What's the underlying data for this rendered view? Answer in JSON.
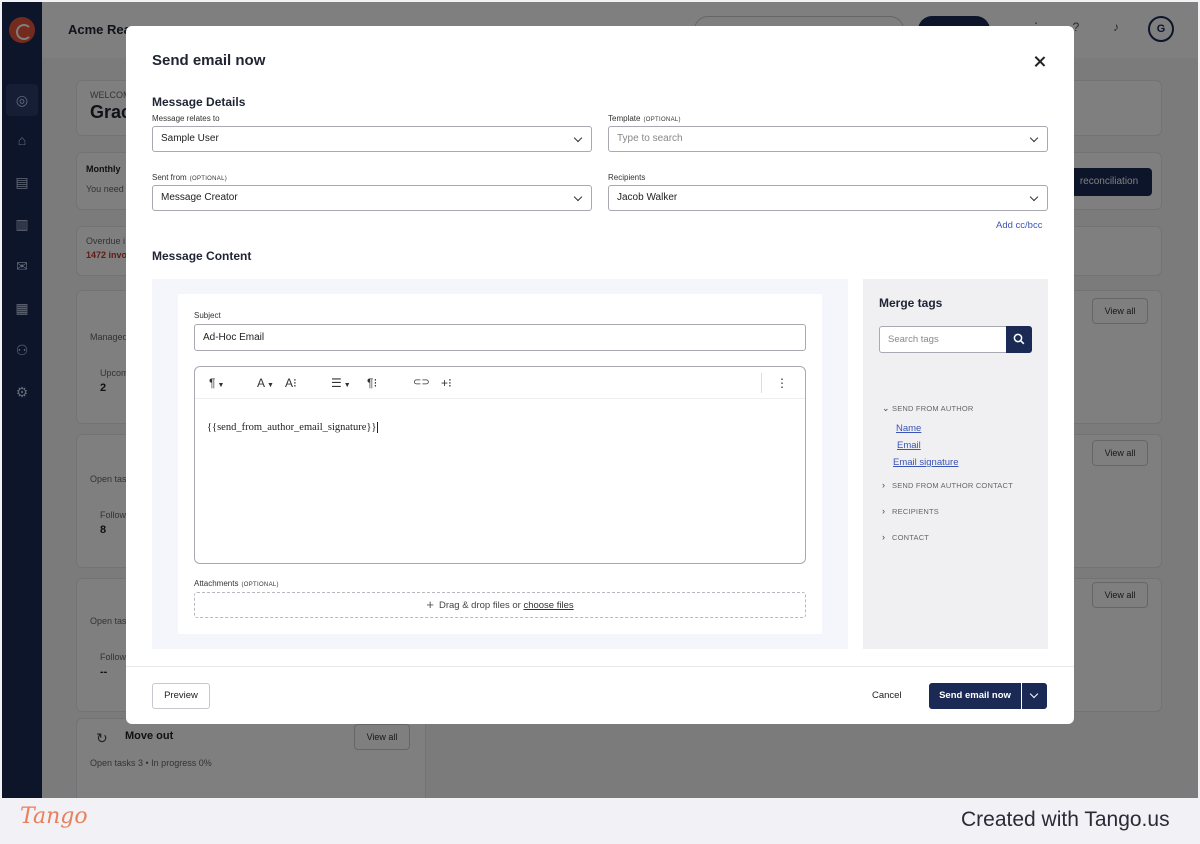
{
  "background": {
    "brand": "Acme Rea",
    "avatar_initial": "G",
    "welcome_small": "WELCOM",
    "welcome_name": "Grac",
    "monthly": "Monthly",
    "you_need": "You need",
    "overdue": "Overdue i",
    "overdue_count": "1472 invo",
    "reconciliation_btn": "reconciliation",
    "managed": "Managed",
    "upcom": "Upcom",
    "upcom_val": "2",
    "open_tasks_a": "Open tas",
    "follow_a": "Follow",
    "follow_a_val": "8",
    "open_tasks_b": "Open tas",
    "follow_b": "Follow",
    "follow_b_val": "--",
    "view_all": "View all",
    "move_out": "Move out",
    "move_out_stats": "Open tasks 3  •  In progress 0%"
  },
  "modal": {
    "title": "Send email now",
    "details_heading": "Message Details",
    "relates_label": "Message relates to",
    "relates_value": "Sample User",
    "template_label": "Template",
    "template_optional": "(OPTIONAL)",
    "template_placeholder": "Type to search",
    "sent_from_label": "Sent from",
    "sent_from_optional": "(OPTIONAL)",
    "sent_from_value": "Message Creator",
    "recipients_label": "Recipients",
    "recipients_value": "Jacob Walker",
    "add_cc_bcc": "Add cc/bcc",
    "content_heading": "Message Content",
    "subject_label": "Subject",
    "subject_value": "Ad-Hoc Email",
    "editor_body": "{{send_from_author_email_signature}}",
    "attachments_label": "Attachments",
    "attachments_optional": "(OPTIONAL)",
    "drop_text": "Drag & drop files or",
    "choose_files": "choose files"
  },
  "toolbar": {
    "paragraph": "¶",
    "font": "A",
    "text_size": "A⁝",
    "list": "☰",
    "para_format": "¶⁝",
    "link": "⊂⊃",
    "insert": "+⁝",
    "more": "⋮"
  },
  "merge_tags": {
    "title": "Merge tags",
    "search_placeholder": "Search tags",
    "groups": {
      "send_from_author": "SEND FROM AUTHOR",
      "send_from_author_contact": "SEND FROM AUTHOR CONTACT",
      "recipients": "RECIPIENTS",
      "contact": "CONTACT"
    },
    "tags": [
      "Name",
      "Email",
      "Email signature"
    ]
  },
  "footer": {
    "preview": "Preview",
    "cancel": "Cancel",
    "send": "Send email now"
  },
  "credit": {
    "logo": "Tango",
    "text": "Created with Tango.us"
  },
  "colors": {
    "primary": "#1b2a55",
    "link": "#3a55b5",
    "tango": "#e9805b"
  }
}
